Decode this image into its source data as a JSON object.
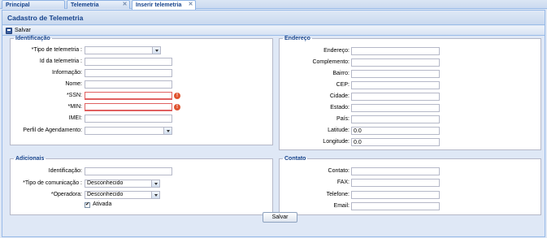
{
  "tabs": [
    {
      "label": "Principal",
      "closable": false
    },
    {
      "label": "Telemetria",
      "closable": true
    },
    {
      "label": "Inserir telemetria",
      "closable": true,
      "active": true
    }
  ],
  "panel": {
    "title": "Cadastro de Telemetria",
    "toolbar_save": "Salvar"
  },
  "identificacao": {
    "legend": "Identificação",
    "tipo_label": "*Tipo de telemetria :",
    "tipo_value": "",
    "id_label": "Id da telemetria :",
    "id_value": "",
    "informacao_label": "Informação:",
    "informacao_value": "",
    "nome_label": "Nome:",
    "nome_value": "",
    "ssn_label": "*SSN:",
    "ssn_value": "",
    "min_label": "*MIN:",
    "min_value": "",
    "imei_label": "IMEI:",
    "imei_value": "",
    "perfil_label": "Perfil de Agendamento:",
    "perfil_value": ""
  },
  "endereco": {
    "legend": "Endereço",
    "fields": [
      {
        "label": "Endereço:",
        "value": ""
      },
      {
        "label": "Complemento:",
        "value": ""
      },
      {
        "label": "Bairro:",
        "value": ""
      },
      {
        "label": "CEP:",
        "value": ""
      },
      {
        "label": "Cidade:",
        "value": ""
      },
      {
        "label": "Estado:",
        "value": ""
      },
      {
        "label": "País:",
        "value": ""
      },
      {
        "label": "Latitude:",
        "value": "0.0"
      },
      {
        "label": "Longitude:",
        "value": "0.0"
      }
    ]
  },
  "adicionais": {
    "legend": "Adicionais",
    "identificacao_label": "Identificação:",
    "identificacao_value": "",
    "tipo_com_label": "*Tipo de comunicação :",
    "tipo_com_value": "Desconhecido",
    "operadora_label": "*Operadora:",
    "operadora_value": "Desconhecido",
    "ativada_label": "Ativada",
    "ativada_checked": true
  },
  "contato": {
    "legend": "Contato",
    "contato_label": "Contato:",
    "fax_label": "FAX:",
    "telefone_label": "Telefone:",
    "email_label": "Email:"
  },
  "footer": {
    "save_label": "Salvar"
  },
  "icons": {
    "save": "save-icon",
    "error": "error-icon",
    "close": "close-icon",
    "dropdown": "chevron-down-icon",
    "check": "checkmark-icon"
  }
}
